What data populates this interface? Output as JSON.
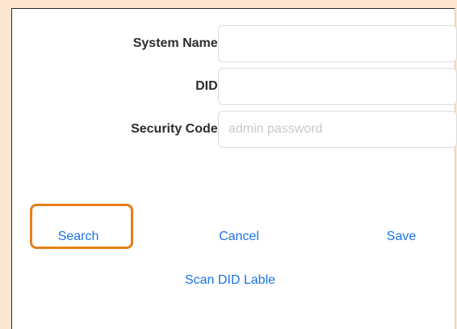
{
  "form": {
    "fields": [
      {
        "label": "System Name:",
        "value": "",
        "placeholder": ""
      },
      {
        "label": "DID:",
        "value": "",
        "placeholder": ""
      },
      {
        "label": "Security Code:",
        "value": "",
        "placeholder": "admin password"
      }
    ]
  },
  "actions": {
    "search_label": "Search",
    "cancel_label": "Cancel",
    "save_label": "Save",
    "scan_label": "Scan DID Lable"
  },
  "colors": {
    "background": "#fbe6cf",
    "link": "#1a73e8",
    "highlight": "#e67e17"
  }
}
